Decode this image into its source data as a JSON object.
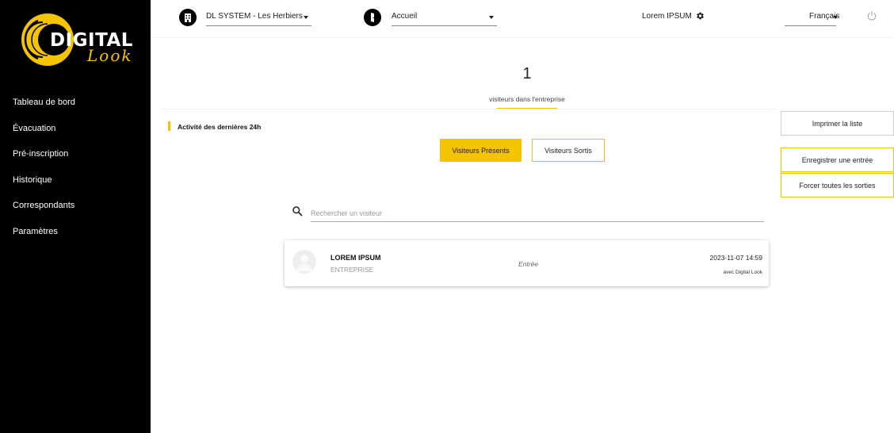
{
  "brand": {
    "name": "DIGITAL",
    "sub": "Look"
  },
  "sidebar": {
    "items": [
      {
        "label": "Tableau de bord"
      },
      {
        "label": "Évacuation"
      },
      {
        "label": "Pré-inscription"
      },
      {
        "label": "Historique"
      },
      {
        "label": "Correspondants"
      },
      {
        "label": "Paramètres"
      }
    ]
  },
  "topbar": {
    "site_select": "DL SYSTEM - Les Herbiers",
    "page_select": "Accueil",
    "user": "Lorem IPSUM",
    "language": "Français"
  },
  "counter": {
    "value": "1",
    "label": "visiteurs dans l'entreprise"
  },
  "activity": {
    "title": "Activité des dernières 24h"
  },
  "tabs": {
    "present": "Visiteurs Présents",
    "left": "Visiteurs Sortis"
  },
  "actions": {
    "print": "Imprimer la liste",
    "register": "Enregistrer une entrée",
    "force_exit": "Forcer toutes les sorties"
  },
  "search": {
    "placeholder": "Rechercher un visiteur",
    "value": ""
  },
  "visitors": [
    {
      "name": "LOREM IPSUM",
      "company": "ENTREPRISE",
      "status": "Entrée",
      "datetime": "2023-11-07 14:59",
      "via": "avec Digital Look"
    }
  ],
  "colors": {
    "accent": "#f5c400",
    "sidebar": "#000000"
  }
}
